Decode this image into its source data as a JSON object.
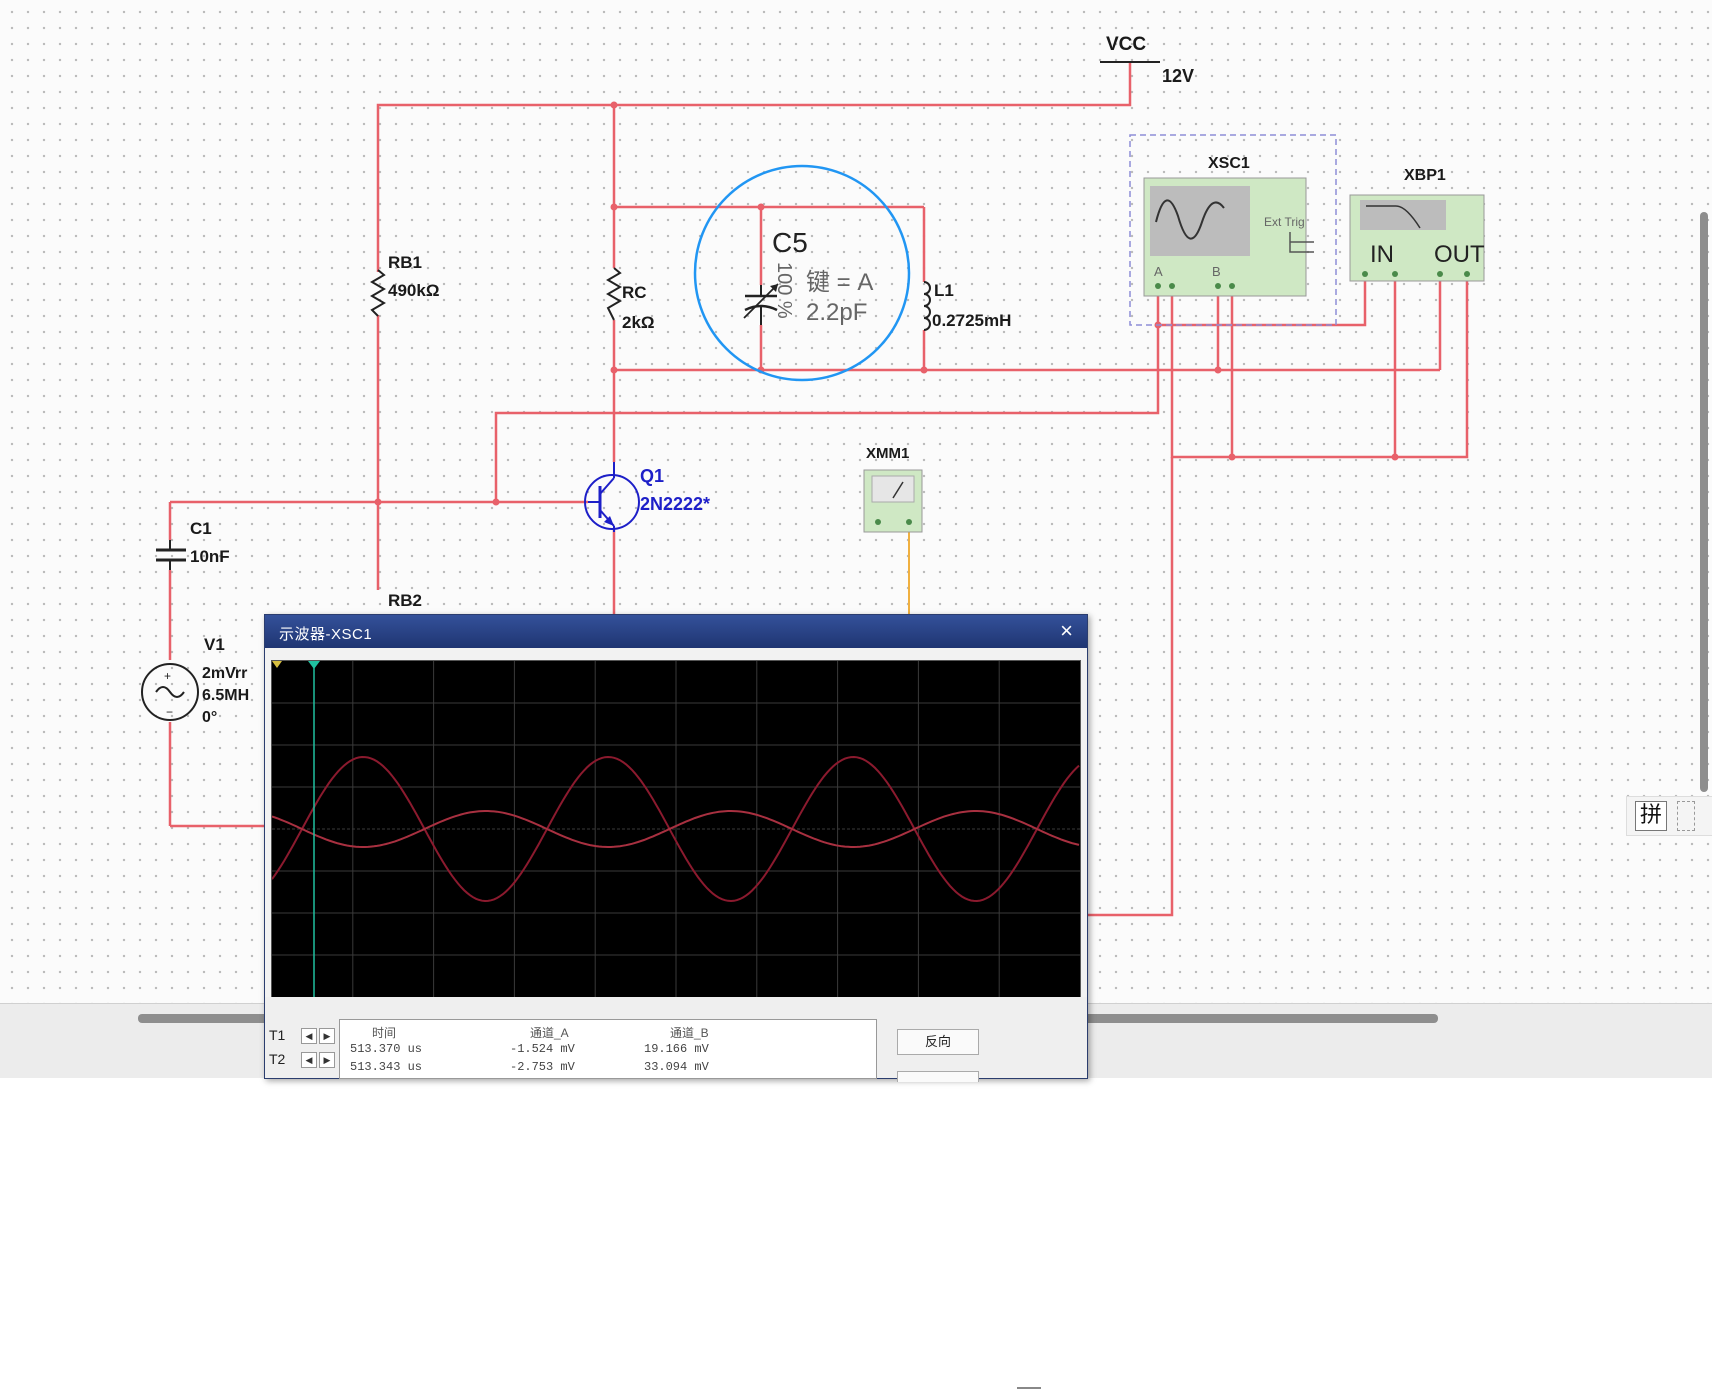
{
  "schematic": {
    "vcc": {
      "name": "VCC",
      "value": "12V"
    },
    "rb1": {
      "name": "RB1",
      "value": "490kΩ"
    },
    "rc": {
      "name": "RC",
      "value": "2kΩ"
    },
    "c5": {
      "name": "C5",
      "key": "键 = A",
      "value": "2.2pF",
      "percent": "100 %"
    },
    "l1": {
      "name": "L1",
      "value": "0.2725mH"
    },
    "q1": {
      "name": "Q1",
      "value": "2N2222*"
    },
    "c1": {
      "name": "C1",
      "value": "10nF"
    },
    "rb2": {
      "name": "RB2"
    },
    "v1": {
      "name": "V1",
      "line1": "2mVrr",
      "line2": "6.5MH",
      "line3": "0°"
    },
    "xsc1": {
      "name": "XSC1",
      "ext_trig": "Ext Trig",
      "port_a": "A",
      "port_b": "B"
    },
    "xbp1": {
      "name": "XBP1",
      "in": "IN",
      "out": "OUT"
    },
    "xmm1": {
      "name": "XMM1"
    },
    "colors": {
      "wire": "#e8616a",
      "highlight_circle": "#2196f3",
      "instrument_fill": "#cfe8c4",
      "probe_wire": "#f0b040"
    }
  },
  "ime": {
    "char": "拼"
  },
  "oscilloscope": {
    "title": "示波器-XSC1",
    "close_label": "×",
    "screen": {
      "background": "#000000",
      "grid_color": "#3a3a3a",
      "trace_a_color": "#8b1a2e",
      "trace_b_color": "#a83040",
      "cursor_color": "#20c0a0"
    },
    "rows_labels": [
      "T1",
      "T2"
    ],
    "readout": {
      "headers": [
        "时间",
        "通道_A",
        "通道_B"
      ],
      "rows": [
        [
          "513.370 us",
          "-1.524 mV",
          "19.166 mV"
        ],
        [
          "513.343 us",
          "-2.753 mV",
          "33.094 mV"
        ]
      ]
    },
    "reverse_button": "反向"
  }
}
